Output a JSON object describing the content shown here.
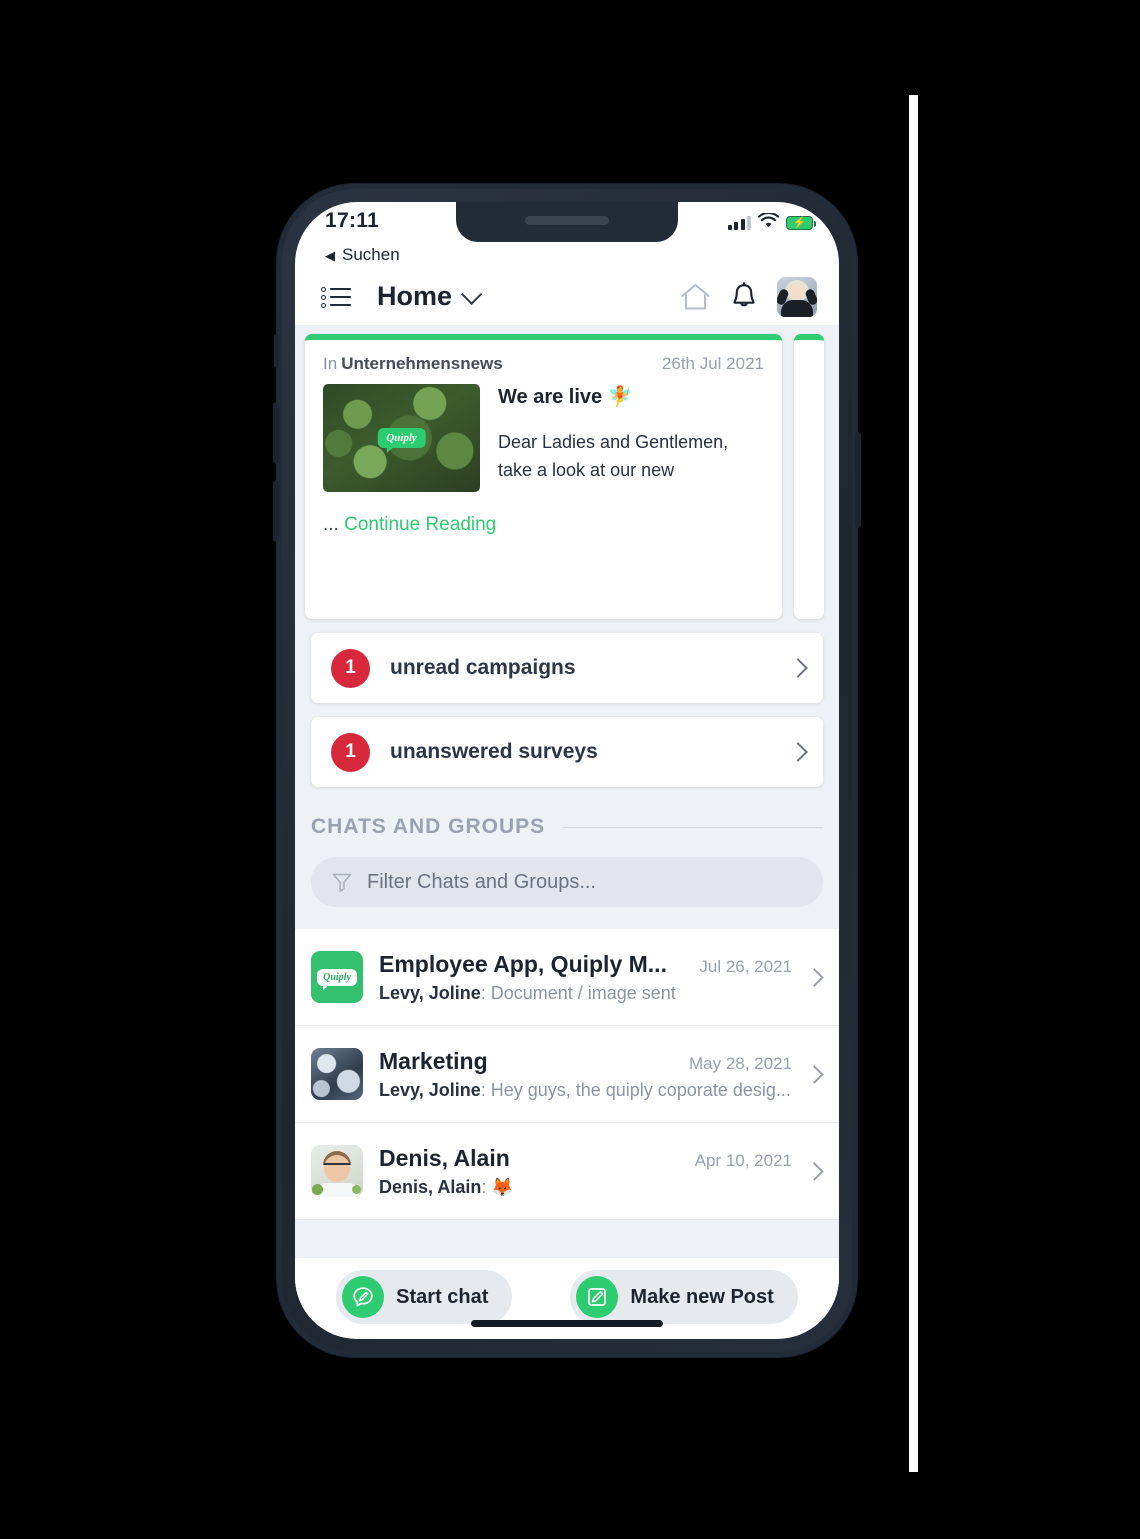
{
  "status_bar": {
    "time": "17:11",
    "back_label": "Suchen",
    "back_arrow": "◀",
    "signal_icon": "cellular-signal-icon",
    "wifi_icon": "wifi-icon",
    "battery_icon": "battery-charging-icon"
  },
  "header": {
    "menu_icon": "list-menu-icon",
    "title": "Home",
    "chevron_icon": "chevron-down-icon",
    "home_icon": "home-icon",
    "bell_icon": "bell-icon",
    "avatar": "user-avatar"
  },
  "news_card": {
    "in_label": "In",
    "channel": "Unternehmensnews",
    "date": "26th Jul 2021",
    "thumbnail_logo": "Quiply",
    "title": "We are live 🧚",
    "body": "Dear Ladies and Gentlemen, take a look at our new",
    "ellipsis": "...",
    "continue_label": "Continue Reading",
    "accent_color": "#2ecc71"
  },
  "notifications": [
    {
      "count": "1",
      "label": "unread campaigns",
      "badge_color": "#d8283c"
    },
    {
      "count": "1",
      "label": "unanswered surveys",
      "badge_color": "#d8283c"
    }
  ],
  "chats_section": {
    "heading": "CHATS AND GROUPS",
    "filter_icon": "funnel-icon",
    "filter_placeholder": "Filter Chats and Groups..."
  },
  "chats": [
    {
      "avatar": "quiply-logo-avatar",
      "name": "Employee App, Quiply M...",
      "date": "Jul 26, 2021",
      "sender": "Levy, Joline",
      "message": ": Document / image sent"
    },
    {
      "avatar": "marketing-group-avatar",
      "name": "Marketing",
      "date": "May 28, 2021",
      "sender": "Levy, Joline",
      "message": ": Hey guys, the quiply coporate desig..."
    },
    {
      "avatar": "denis-alain-avatar",
      "name": "Denis, Alain",
      "date": "Apr 10, 2021",
      "sender": "Denis, Alain",
      "message": ": 🦊"
    }
  ],
  "action_bar": {
    "start_chat": {
      "label": "Start chat",
      "icon": "chat-compose-icon"
    },
    "make_post": {
      "label": "Make new Post",
      "icon": "pencil-square-icon"
    },
    "accent_color": "#2ecc71"
  }
}
